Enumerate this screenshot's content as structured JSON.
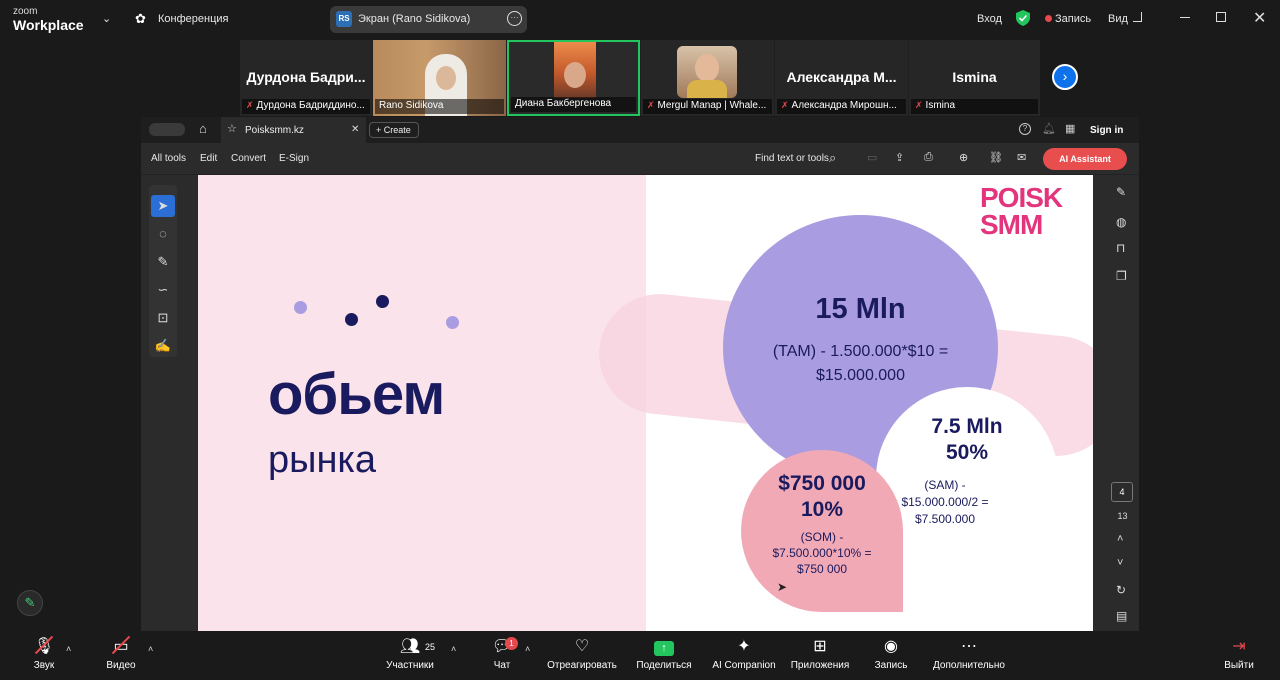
{
  "titlebar": {
    "logo_line1": "zoom",
    "logo_line2": "Workplace",
    "meeting_label": "Конференция",
    "share_label": "Экран (Rano Sidikova)",
    "share_badge": "RS",
    "login": "Вход",
    "record": "Запись",
    "view": "Вид"
  },
  "participants": [
    {
      "big": "Дурдона Бадри...",
      "name": "Дурдона Бадриддино..."
    },
    {
      "big": "",
      "name": "Rano Sidikova"
    },
    {
      "big": "",
      "name": "Диана Бакбергенова"
    },
    {
      "big": "",
      "name": "Mergul Manap | Whale..."
    },
    {
      "big": "Александра М...",
      "name": "Александра Мирошн..."
    },
    {
      "big": "Ismina",
      "name": "Ismina"
    }
  ],
  "acrobat": {
    "tab_title": "Poisksmm.kz",
    "create": "Create",
    "sign_in": "Sign in",
    "menu": [
      "All tools",
      "Edit",
      "Convert",
      "E-Sign"
    ],
    "find": "Find text or tools",
    "ai_assistant": "AI Assistant",
    "page_current": "4",
    "page_total": "13"
  },
  "slide": {
    "title": "обьем",
    "subtitle": "рынка",
    "logo_top": "POISK",
    "logo_bottom": "SMM",
    "tam_value": "15 Mln",
    "tam_desc": "(TAM) - 1.500.000*$10 =",
    "tam_total": "$15.000.000",
    "sam_value": "7.5 Mln",
    "sam_pct": "50%",
    "sam_desc1": "(SAM) -",
    "sam_desc2": "$15.000.000/2 =",
    "sam_total": "$7.500.000",
    "som_value": "$750 000",
    "som_pct": "10%",
    "som_desc1": "(SOM) -",
    "som_desc2": "$7.500.000*10% =",
    "som_total": "$750 000"
  },
  "bottombar": {
    "mic": "Звук",
    "video": "Видео",
    "participants": "Участники",
    "participants_count": "25",
    "chat": "Чат",
    "chat_badge": "1",
    "react": "Отреагировать",
    "share": "Поделиться",
    "ai": "AI Companion",
    "apps": "Приложения",
    "record": "Запись",
    "more": "Дополнительно",
    "leave": "Выйти"
  },
  "colors": {
    "accent": "#0e72ed",
    "share_green": "#22c55e",
    "danger": "#e5484d",
    "slide_navy": "#1a1a5e",
    "slide_pink": "#e2357e"
  }
}
